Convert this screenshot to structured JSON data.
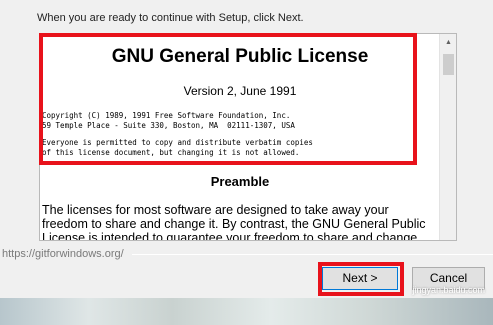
{
  "header": {
    "instruction": "When you are ready to continue with Setup, click Next."
  },
  "license": {
    "title": "GNU General Public License",
    "version": "Version 2, June 1991",
    "copyright_line1": "Copyright (C) 1989, 1991 Free Software Foundation, Inc.",
    "copyright_line2": "59 Temple Place - Suite 330, Boston, MA  02111-1307, USA",
    "notice_line1": "Everyone is permitted to copy and distribute verbatim copies",
    "notice_line2": "of this license document, but changing it is not allowed.",
    "preamble_heading": "Preamble",
    "preamble_text": "The licenses for most software are designed to take away your freedom to share and change it. By contrast, the GNU General Public License is intended to guarantee your freedom to share and change"
  },
  "footer": {
    "url": "https://gitforwindows.org/",
    "next_label": "Next >",
    "cancel_label": "Cancel"
  },
  "watermark": {
    "text": "jingyan.baidu.com"
  },
  "colors": {
    "highlight": "#e8121b",
    "focus": "#0078d7"
  }
}
